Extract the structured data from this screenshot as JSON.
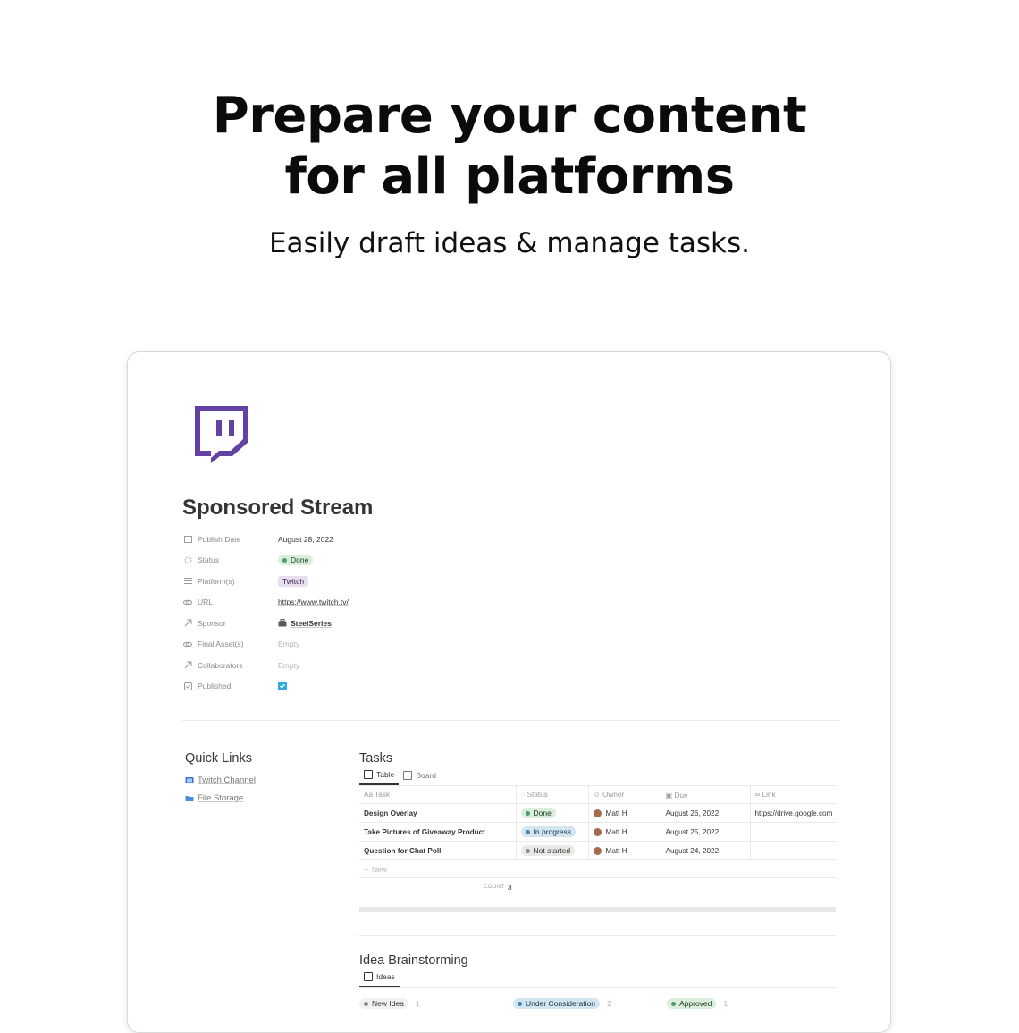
{
  "hero": {
    "title_line1": "Prepare your content",
    "title_line2": "for all platforms",
    "subtitle": "Easily draft ideas & manage tasks."
  },
  "page": {
    "title": "Sponsored Stream",
    "icon": "twitch-logo",
    "properties": [
      {
        "name": "Publish Date",
        "icon": "calendar-icon",
        "value": "August 28, 2022"
      },
      {
        "name": "Status",
        "icon": "status-icon",
        "value": "Done"
      },
      {
        "name": "Platform(s)",
        "icon": "list-icon",
        "value": "Twitch"
      },
      {
        "name": "URL",
        "icon": "link-icon",
        "value": "https://www.twitch.tv/"
      },
      {
        "name": "Sponsor",
        "icon": "relation-arrow-icon",
        "value": "SteelSeries"
      },
      {
        "name": "Final Asset(s)",
        "icon": "link-icon",
        "value": "Empty"
      },
      {
        "name": "Collaborators",
        "icon": "relation-arrow-icon",
        "value": "Empty"
      },
      {
        "name": "Published",
        "icon": "checkbox-icon",
        "value": "checked"
      }
    ]
  },
  "quick_links": {
    "title": "Quick Links",
    "items": [
      {
        "label": "Twitch Channel",
        "icon": "tv-icon",
        "color": "#3b6fd8"
      },
      {
        "label": "File Storage",
        "icon": "folder-icon",
        "color": "#4a90d9"
      }
    ]
  },
  "tasks": {
    "title": "Tasks",
    "views": [
      "Table",
      "Board"
    ],
    "columns": [
      "Task",
      "Status",
      "Owner",
      "Due",
      "Link"
    ],
    "rows": [
      {
        "task": "Design Overlay",
        "status": "Done",
        "owner": "Matt H",
        "due": "August 26, 2022",
        "link": "https://drive.google.com"
      },
      {
        "task": "Take Pictures of Giveaway Product",
        "status": "In progress",
        "owner": "Matt H",
        "due": "August 25, 2022",
        "link": ""
      },
      {
        "task": "Question for Chat Poll",
        "status": "Not started",
        "owner": "Matt H",
        "due": "August 24, 2022",
        "link": ""
      }
    ],
    "new_label": "New",
    "count_label": "COUNT",
    "count_value": "3"
  },
  "ideas": {
    "title": "Idea Brainstorming",
    "view": "Ideas",
    "groups": [
      {
        "label": "New Idea",
        "count": "1"
      },
      {
        "label": "Under Consideration",
        "count": "2"
      },
      {
        "label": "Approved",
        "count": "1"
      }
    ]
  },
  "colors": {
    "twitch_purple": "#6441a5",
    "checkbox_blue": "#2eaadc"
  }
}
